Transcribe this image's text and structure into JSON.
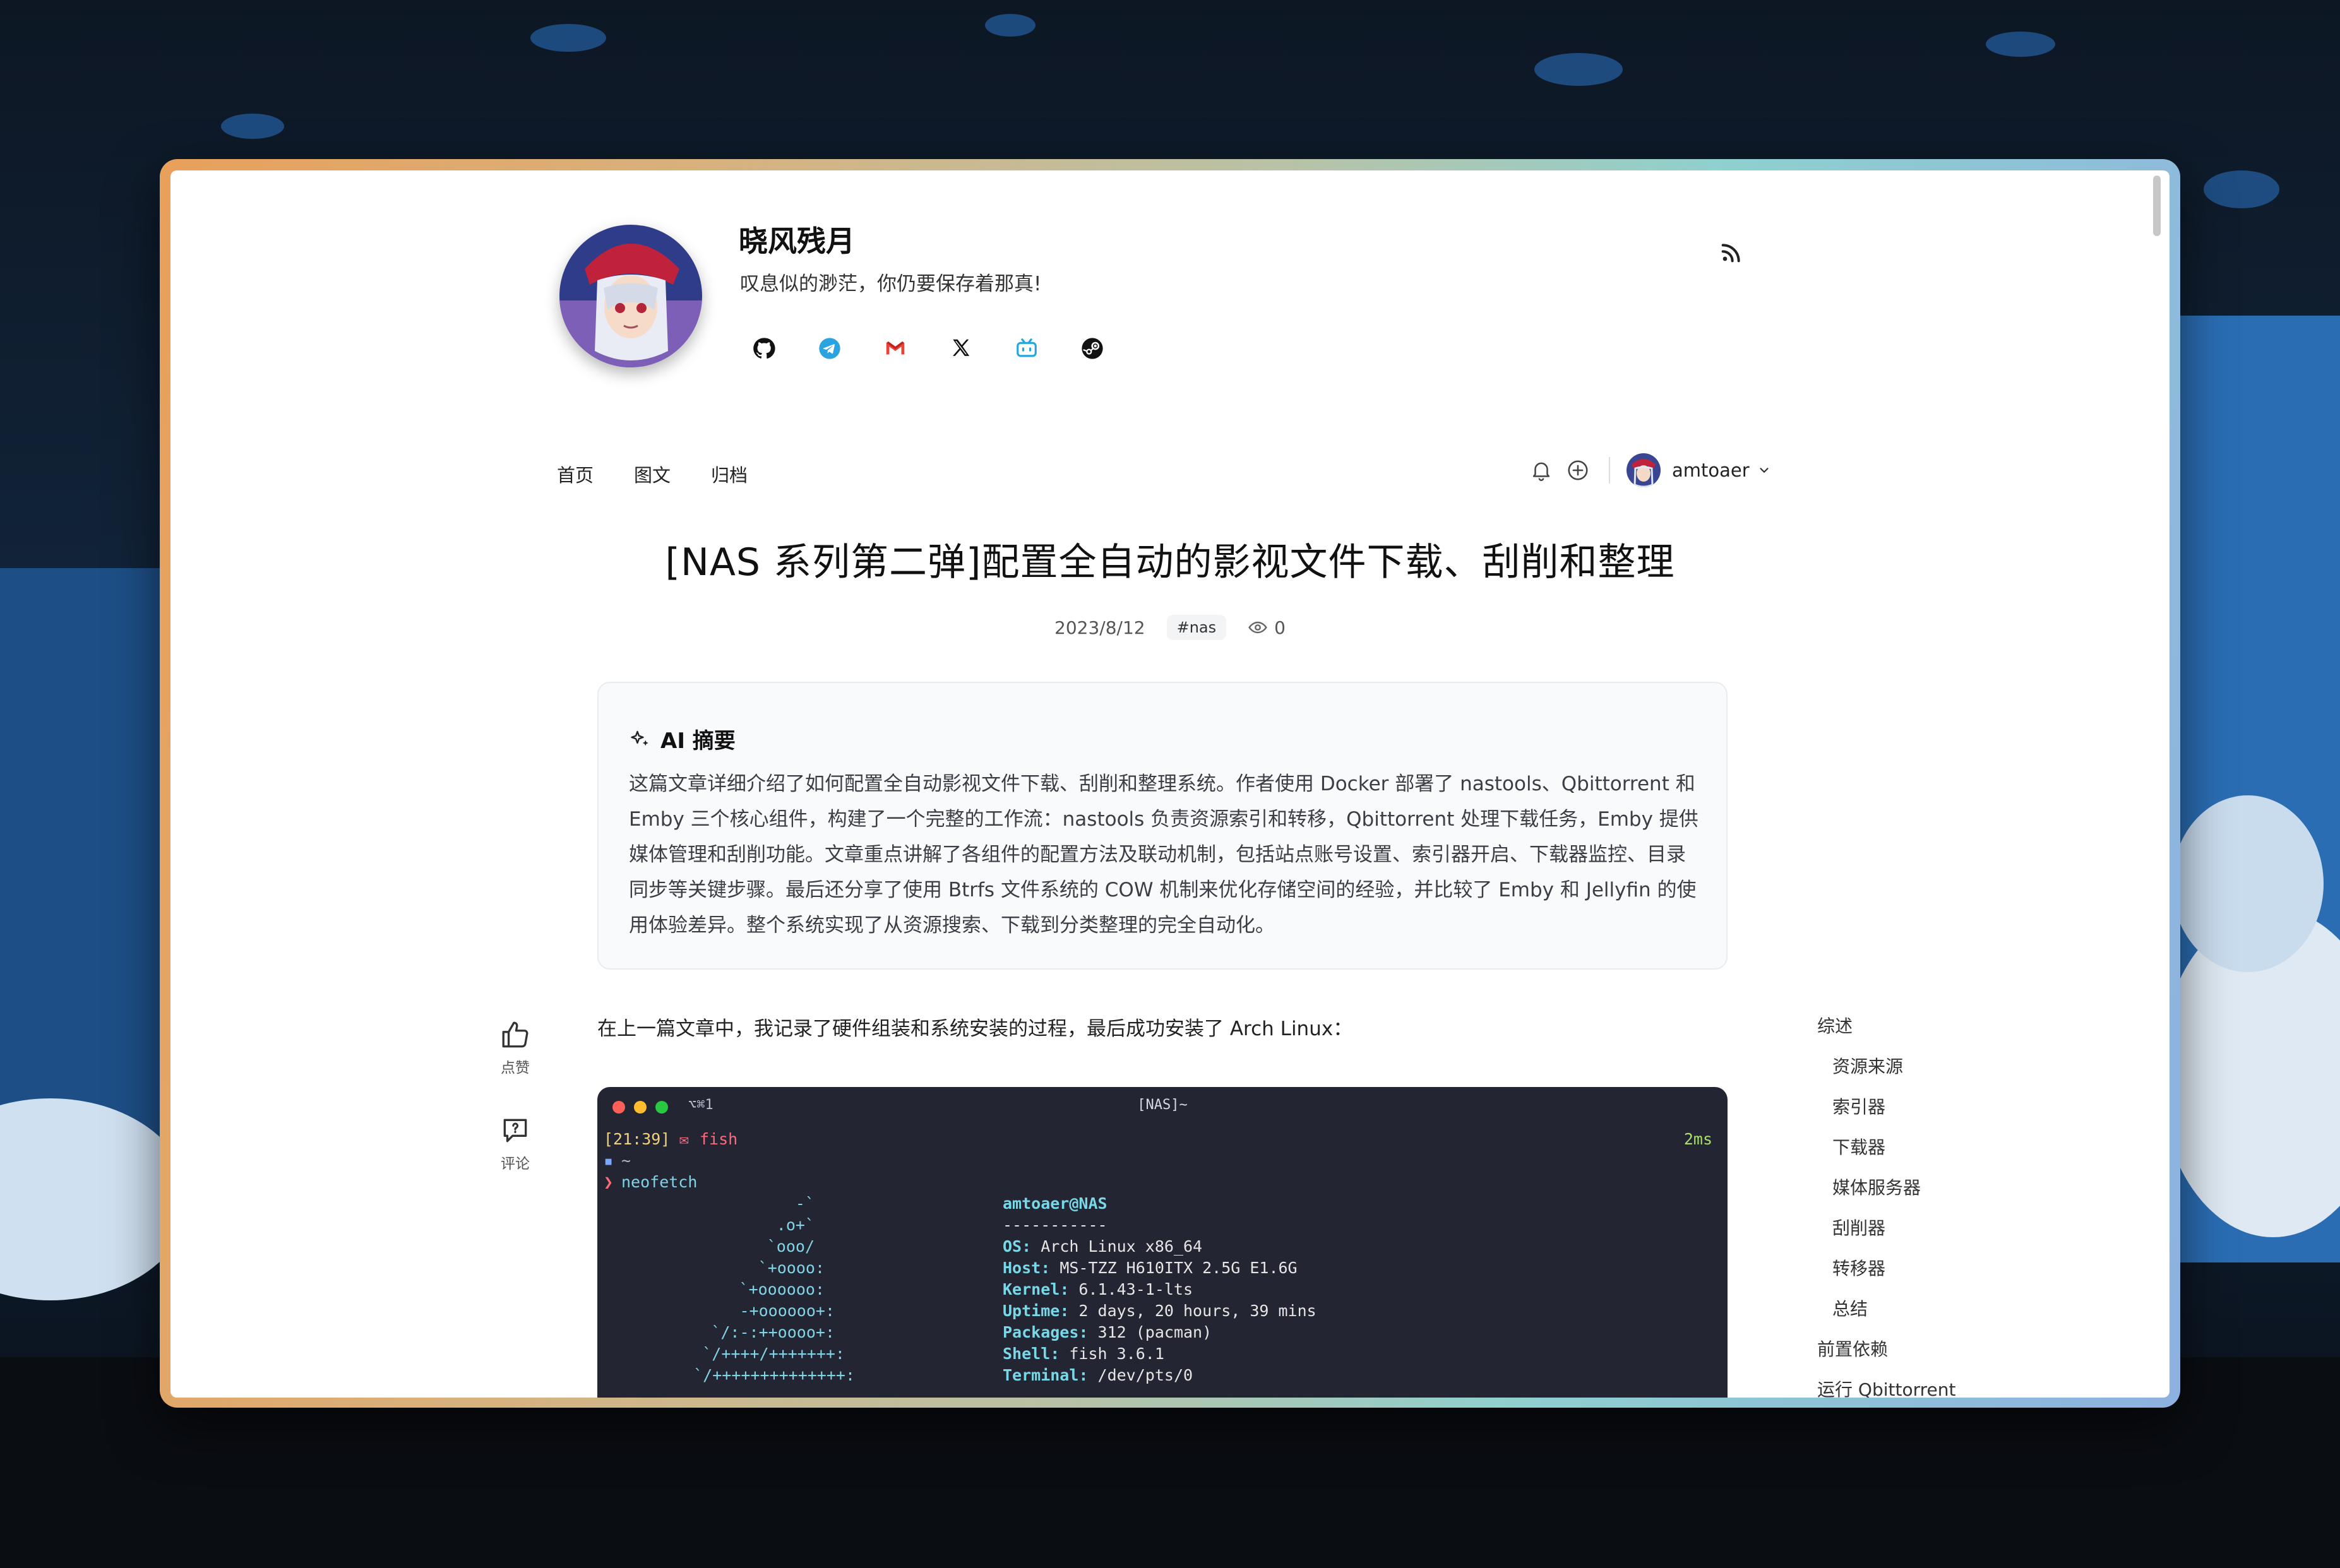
{
  "site": {
    "title": "晓风残月",
    "subtitle": "叹息似的渺茫，你仍要保存着那真!",
    "social_icons": [
      "github-icon",
      "telegram-icon",
      "gmail-icon",
      "x-icon",
      "bilibili-icon",
      "steam-icon"
    ],
    "rss_icon": "rss-icon"
  },
  "nav": {
    "items": [
      "首页",
      "图文",
      "归档"
    ],
    "user": "amtoaer"
  },
  "post": {
    "title": "[NAS 系列第二弹]配置全自动的影视文件下载、刮削和整理",
    "date": "2023/8/12",
    "tag": "#nas",
    "views": "0"
  },
  "summary": {
    "heading": "AI 摘要",
    "text": "这篇文章详细介绍了如何配置全自动影视文件下载、刮削和整理系统。作者使用 Docker 部署了 nastools、Qbittorrent 和 Emby 三个核心组件，构建了一个完整的工作流：nastools 负责资源索引和转移，Qbittorrent 处理下载任务，Emby 提供媒体管理和刮削功能。文章重点讲解了各组件的配置方法及联动机制，包括站点账号设置、索引器开启、下载器监控、目录同步等关键步骤。最后还分享了使用 Btrfs 文件系统的 COW 机制来优化存储空间的经验，并比较了 Emby 和 Jellyfin 的使用体验差异。整个系统实现了从资源搜索、下载到分类整理的完全自动化。"
  },
  "intro": "在上一篇文章中，我记录了硬件组装和系统安装的过程，最后成功安装了 Arch Linux：",
  "actions": {
    "like": "点赞",
    "comment": "评论"
  },
  "toc": [
    {
      "label": "综述",
      "level": 1
    },
    {
      "label": "资源来源",
      "level": 2
    },
    {
      "label": "索引器",
      "level": 2
    },
    {
      "label": "下载器",
      "level": 2
    },
    {
      "label": "媒体服务器",
      "level": 2
    },
    {
      "label": "刮削器",
      "level": 2
    },
    {
      "label": "转移器",
      "level": 2
    },
    {
      "label": "总结",
      "level": 2
    },
    {
      "label": "前置依赖",
      "level": 1
    },
    {
      "label": "运行 Qbittorrent",
      "level": 1
    }
  ],
  "terminal": {
    "shortcut": "⌥⌘1",
    "title": "[NAS]~",
    "time": "[21:39]",
    "shell": "fish",
    "duration": "2ms",
    "cwd": "~",
    "command": "neofetch",
    "logo": [
      "-`",
      ".o+`",
      "`ooo/",
      "`+oooo:",
      "`+oooooo:",
      "-+oooooo+:",
      "`/:-:++oooo+:",
      "`/++++/+++++++:",
      "`/++++++++++++++:"
    ],
    "user_host": "amtoaer@NAS",
    "separator": "-----------",
    "info": [
      {
        "k": "OS",
        "v": "Arch Linux x86_64"
      },
      {
        "k": "Host",
        "v": "MS-TZZ H610ITX 2.5G E1.6G"
      },
      {
        "k": "Kernel",
        "v": "6.1.43-1-lts"
      },
      {
        "k": "Uptime",
        "v": "2 days, 20 hours, 39 mins"
      },
      {
        "k": "Packages",
        "v": "312 (pacman)"
      },
      {
        "k": "Shell",
        "v": "fish 3.6.1"
      },
      {
        "k": "Terminal",
        "v": "/dev/pts/0"
      }
    ]
  }
}
